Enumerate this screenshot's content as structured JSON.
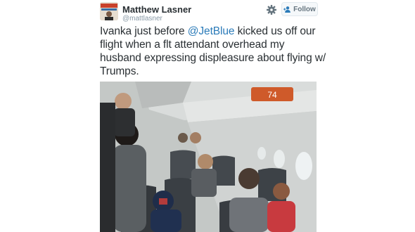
{
  "tweet": {
    "author_name": "Matthew Lasner",
    "author_handle": "@mattlasner",
    "follow_label": "Follow",
    "text_line1_before": "Ivanka just before ",
    "mention": "@JetBlue",
    "text_line1_after": " kicked us off our",
    "text_line2": "flight when a flt attendant overhead my",
    "text_line3": "husband expressing displeasure about flying w/",
    "text_line4": "Trumps.",
    "overhead_bin_number": "74"
  },
  "icons": {
    "settings": "gear-icon",
    "follow": "add-user-icon"
  },
  "colors": {
    "link": "#2b7bb9",
    "name": "#292f33",
    "handle": "#8899a6",
    "follow_text": "#66757f"
  }
}
